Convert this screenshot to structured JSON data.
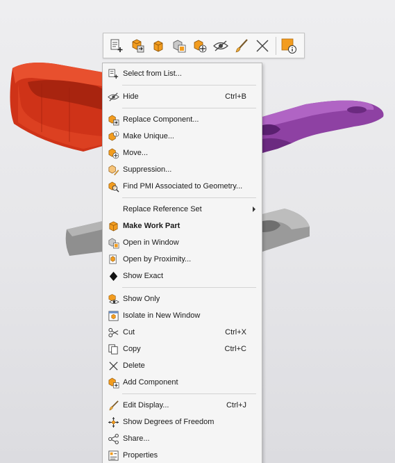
{
  "colors": {
    "red_part": "#d83a1e",
    "purple_part": "#8a3f9e",
    "gray_part": "#9a9a9a",
    "menu_bg": "#f5f5f5",
    "accent_orange": "#f29c1f"
  },
  "toolbar": {
    "buttons": [
      {
        "icon": "select-from-list-icon"
      },
      {
        "icon": "replace-component-icon"
      },
      {
        "icon": "make-work-part-icon"
      },
      {
        "icon": "open-in-window-icon"
      },
      {
        "icon": "move-component-icon"
      },
      {
        "icon": "hide-icon"
      },
      {
        "icon": "edit-display-icon"
      },
      {
        "icon": "delete-icon"
      },
      {
        "icon": "information-icon"
      }
    ]
  },
  "menu": {
    "items": [
      {
        "label": "Select from List...",
        "shortcut": "",
        "icon": "select-from-list-icon"
      },
      {
        "label": "Hide",
        "shortcut": "Ctrl+B",
        "icon": "hide-icon"
      },
      {
        "label": "Replace Component...",
        "shortcut": "",
        "icon": "replace-component-icon"
      },
      {
        "label": "Make Unique...",
        "shortcut": "",
        "icon": "make-unique-icon"
      },
      {
        "label": "Move...",
        "shortcut": "",
        "icon": "move-icon"
      },
      {
        "label": "Suppression...",
        "shortcut": "",
        "icon": "suppression-icon"
      },
      {
        "label": "Find PMI Associated to Geometry...",
        "shortcut": "",
        "icon": "find-pmi-icon"
      },
      {
        "label": "Replace Reference Set",
        "shortcut": "",
        "icon": ""
      },
      {
        "label": "Make Work Part",
        "shortcut": "",
        "icon": "make-work-part-icon"
      },
      {
        "label": "Open in Window",
        "shortcut": "",
        "icon": "open-in-window-icon"
      },
      {
        "label": "Open by Proximity...",
        "shortcut": "",
        "icon": "open-by-proximity-icon"
      },
      {
        "label": "Show Exact",
        "shortcut": "",
        "icon": "diamond-icon"
      },
      {
        "label": "Show Only",
        "shortcut": "",
        "icon": "show-only-icon"
      },
      {
        "label": "Isolate in New Window",
        "shortcut": "",
        "icon": "isolate-icon"
      },
      {
        "label": "Cut",
        "shortcut": "Ctrl+X",
        "icon": "scissors-icon"
      },
      {
        "label": "Copy",
        "shortcut": "Ctrl+C",
        "icon": "copy-icon"
      },
      {
        "label": "Delete",
        "shortcut": "",
        "icon": "delete-icon"
      },
      {
        "label": "Add Component",
        "shortcut": "",
        "icon": "add-component-icon"
      },
      {
        "label": "Edit Display...",
        "shortcut": "Ctrl+J",
        "icon": "brush-icon"
      },
      {
        "label": "Show Degrees of Freedom",
        "shortcut": "",
        "icon": "degrees-of-freedom-icon"
      },
      {
        "label": "Share...",
        "shortcut": "",
        "icon": "share-icon"
      },
      {
        "label": "Properties",
        "shortcut": "",
        "icon": "properties-icon"
      }
    ]
  }
}
